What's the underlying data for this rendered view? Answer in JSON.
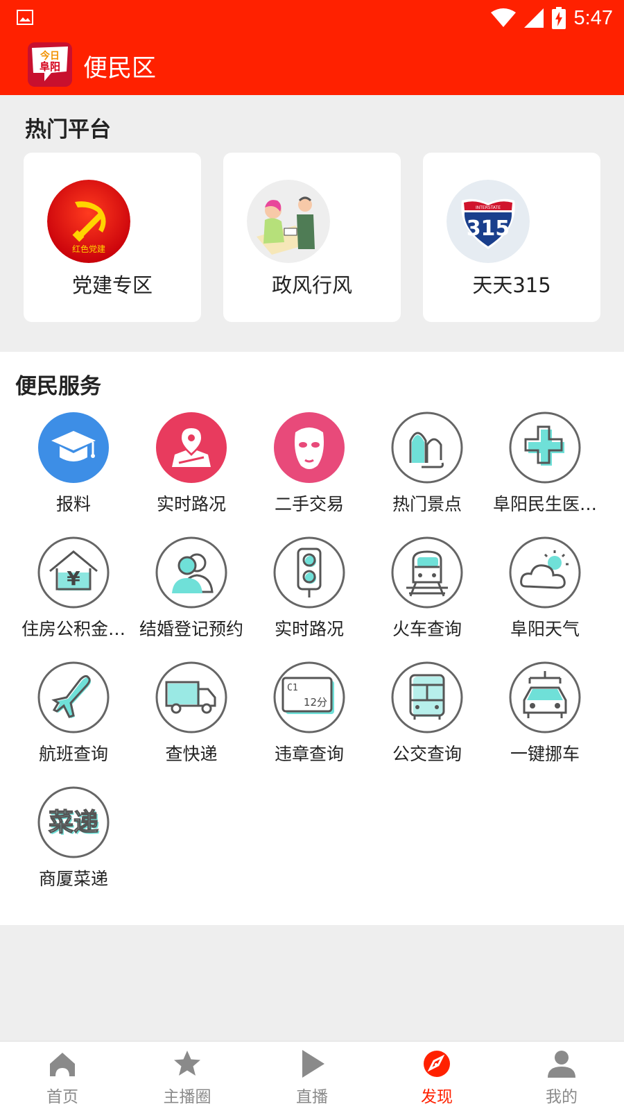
{
  "status_bar": {
    "time": "5:47"
  },
  "app_bar": {
    "title": "便民区",
    "logo_text_top": "今日",
    "logo_text_bottom": "阜阳"
  },
  "hot_platforms": {
    "title": "热门平台",
    "items": [
      {
        "label": "党建专区",
        "icon": "party-emblem-icon",
        "badge_text": "红色党建"
      },
      {
        "label": "政风行风",
        "icon": "consultation-illustration-icon"
      },
      {
        "label": "天天315",
        "icon": "interstate-315-shield-icon",
        "shield_top": "INTERSTATE",
        "shield_number": "315"
      }
    ]
  },
  "services": {
    "title": "便民服务",
    "items": [
      {
        "label": "报料",
        "icon": "graduation-cap-icon"
      },
      {
        "label": "实时路况",
        "icon": "map-pin-icon"
      },
      {
        "label": "二手交易",
        "icon": "mask-icon"
      },
      {
        "label": "热门景点",
        "icon": "landmark-arches-icon"
      },
      {
        "label": "阜阳民生医…",
        "icon": "medical-cross-icon"
      },
      {
        "label": "住房公积金…",
        "icon": "house-yen-icon"
      },
      {
        "label": "结婚登记预约",
        "icon": "couple-icon"
      },
      {
        "label": "实时路况",
        "icon": "traffic-light-icon"
      },
      {
        "label": "火车查询",
        "icon": "train-icon"
      },
      {
        "label": "阜阳天气",
        "icon": "weather-cloud-sun-icon"
      },
      {
        "label": "航班查询",
        "icon": "airplane-icon"
      },
      {
        "label": "查快递",
        "icon": "delivery-truck-icon"
      },
      {
        "label": "违章查询",
        "icon": "violation-ticket-icon",
        "ticket_line1": "C1",
        "ticket_line2": "12分"
      },
      {
        "label": "公交查询",
        "icon": "bus-icon"
      },
      {
        "label": "一键挪车",
        "icon": "move-car-icon"
      },
      {
        "label": "商厦菜递",
        "icon": "grocery-delivery-icon",
        "icon_text": "菜递"
      }
    ]
  },
  "bottom_nav": {
    "items": [
      {
        "label": "首页",
        "icon": "home-icon"
      },
      {
        "label": "主播圈",
        "icon": "star-icon"
      },
      {
        "label": "直播",
        "icon": "play-icon"
      },
      {
        "label": "发现",
        "icon": "compass-icon",
        "active": true
      },
      {
        "label": "我的",
        "icon": "person-icon"
      }
    ]
  },
  "colors": {
    "brand_red": "#ff2100",
    "accent_teal": "#6fe0d8",
    "icon_gray": "#666666"
  }
}
